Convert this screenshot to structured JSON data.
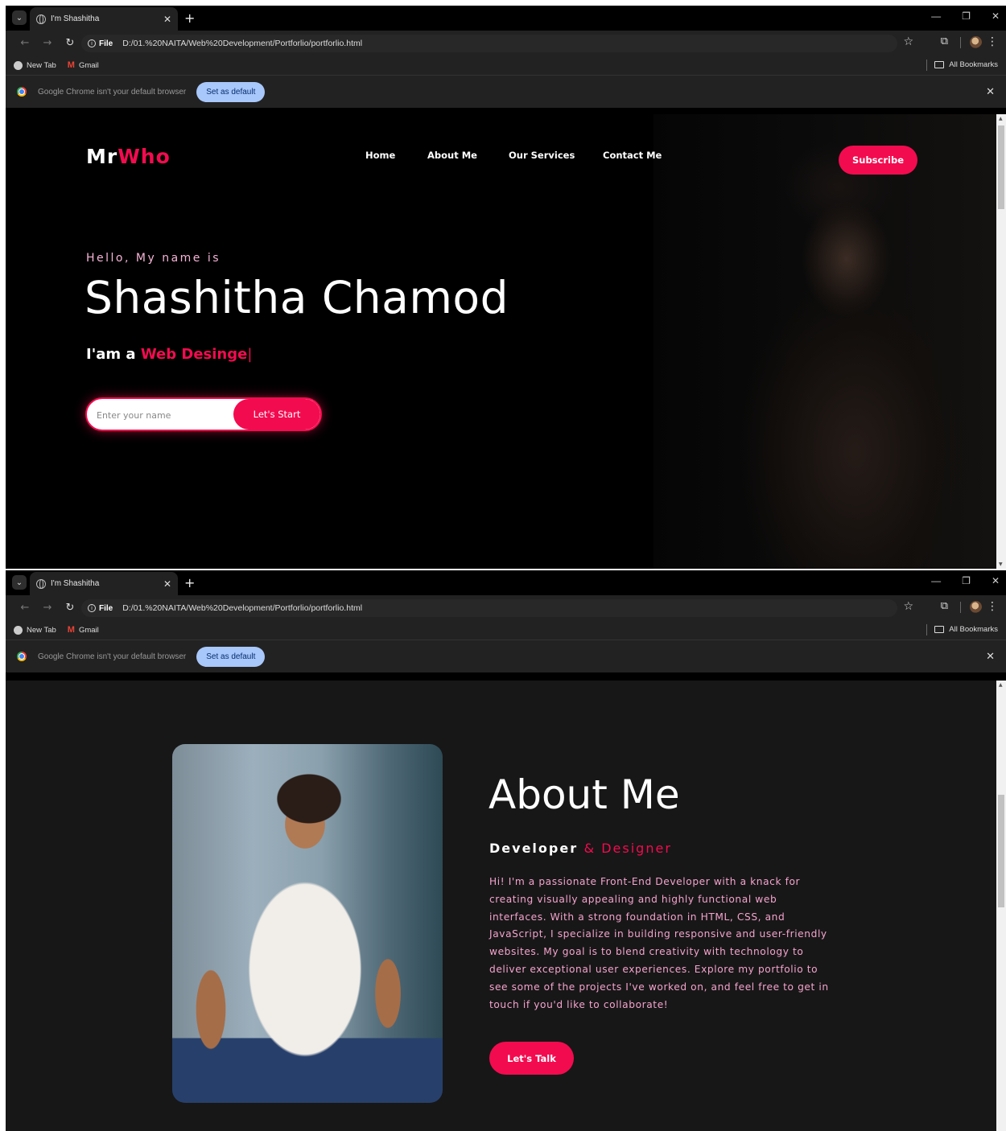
{
  "browser": {
    "tab_title": "I'm Shashitha",
    "file_chip": "File",
    "url": "D:/01.%20NAITA/Web%20Development/Portforlio/portforlio.html",
    "bookmarks": [
      {
        "label": "New Tab",
        "icon": "globe-icon"
      },
      {
        "label": "Gmail",
        "icon": "gmail-icon"
      }
    ],
    "all_bookmarks": "All Bookmarks",
    "infobar_message": "Google Chrome isn't your default browser",
    "set_default_label": "Set as default"
  },
  "hero": {
    "logo_main": "Mr",
    "logo_accent": "Who",
    "nav": [
      "Home",
      "About Me",
      "Our Services",
      "Contact Me"
    ],
    "subscribe_label": "Subscribe",
    "greeting": "Hello, My name is",
    "name": "Shashitha Chamod",
    "role_prefix": "I'am a",
    "role_typed": "Web Desinge",
    "role_cursor": "|",
    "input_placeholder": "Enter your name",
    "start_label": "Let's Start"
  },
  "about": {
    "title": "About Me",
    "sub_main": "Developer",
    "sub_accent": "& Designer",
    "text": "Hi! I'm a passionate Front-End Developer with a knack for creating visually appealing and highly functional web interfaces. With a strong foundation in HTML, CSS, and JavaScript, I specialize in building responsive and user-friendly websites. My goal is to blend creativity with technology to deliver exceptional user experiences. Explore my portfolio to see some of the projects I've worked on, and feel free to get in touch if you'd like to collaborate!",
    "talk_label": "Let's Talk"
  },
  "colors": {
    "accent": "#f30b4f",
    "pink_text": "#f5a3cd",
    "page_bg_hero": "#000000",
    "page_bg_about": "#171717"
  }
}
